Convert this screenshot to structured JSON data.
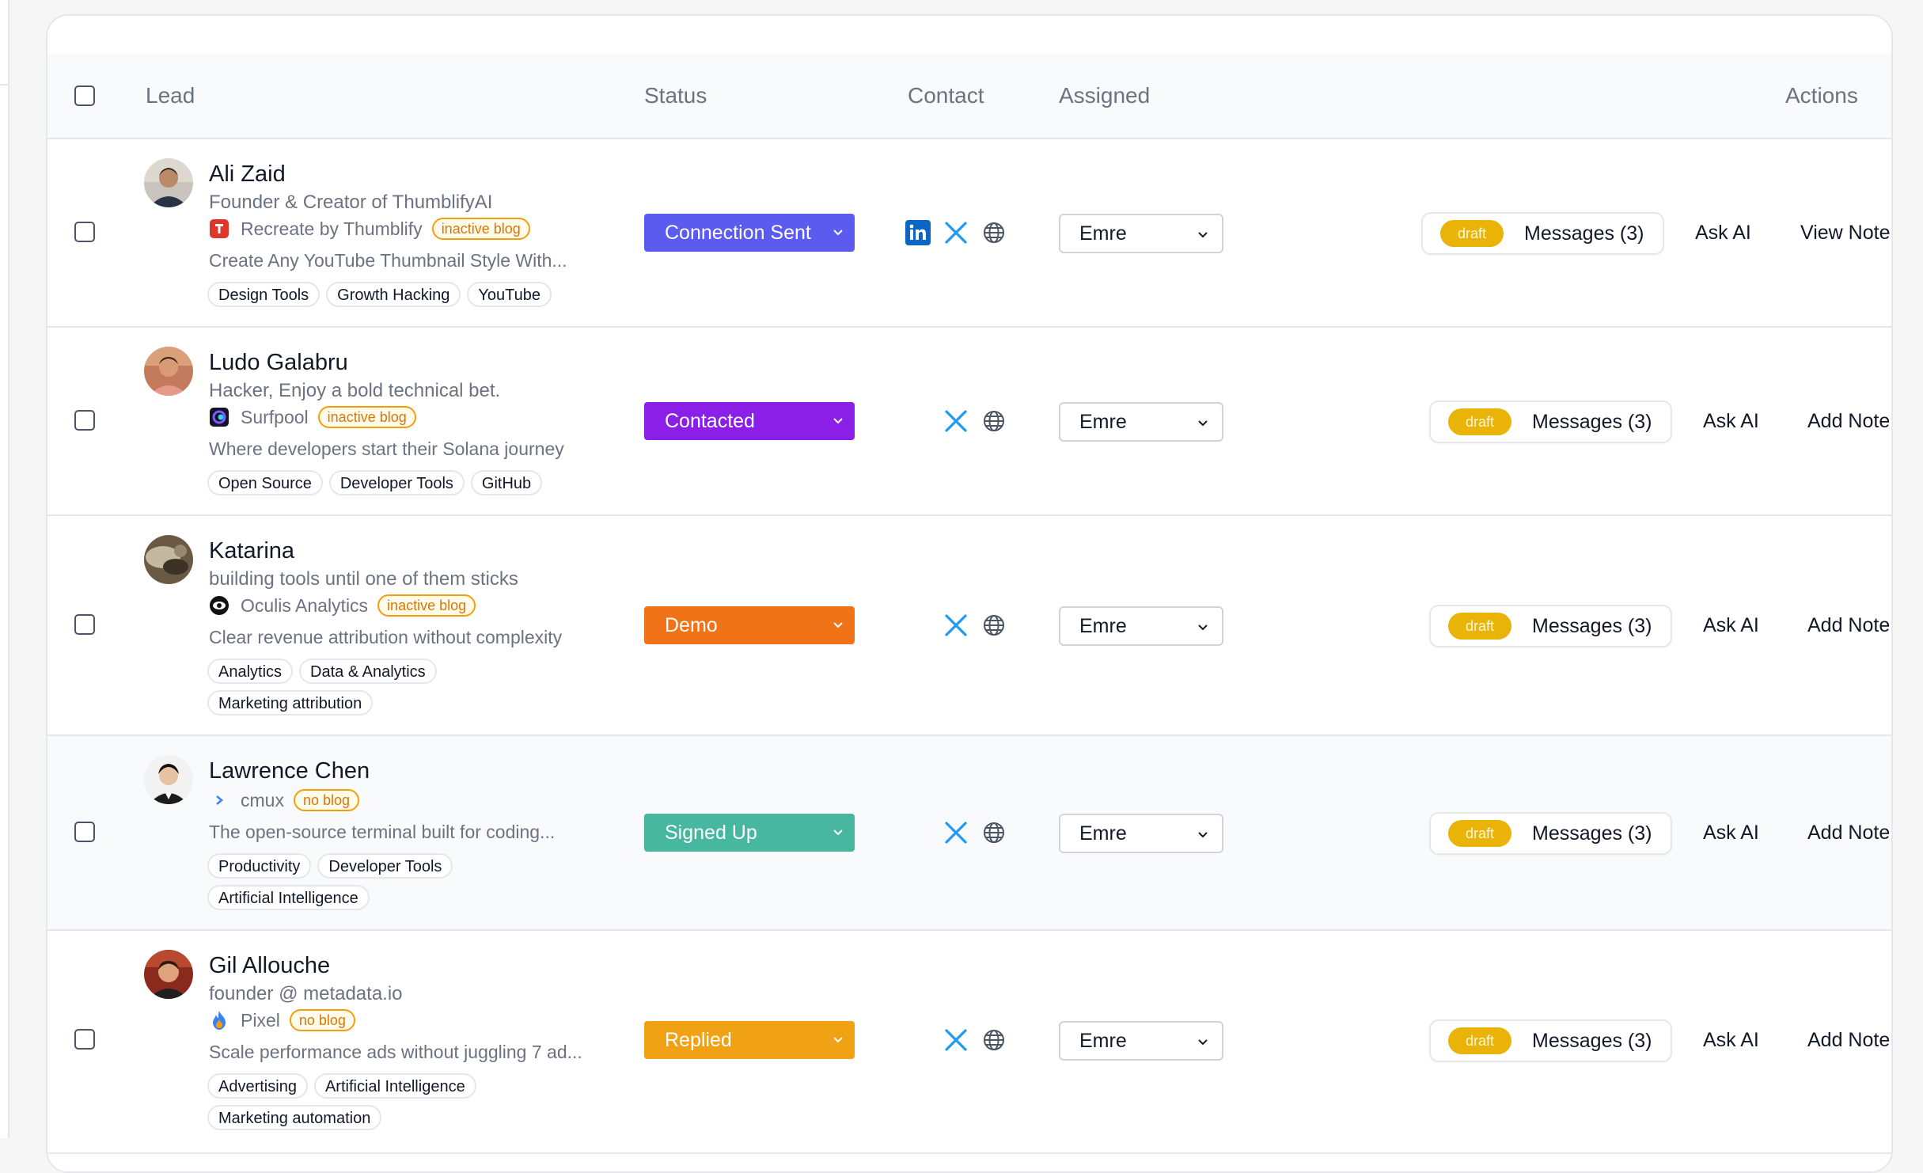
{
  "columns": {
    "lead": "Lead",
    "status": "Status",
    "contact": "Contact",
    "assigned": "Assigned",
    "actions": "Actions"
  },
  "colors": {
    "connection_sent": "#5b5bf0",
    "contacted": "#8b1fe8",
    "demo": "#f07317",
    "signed_up": "#47b7a0",
    "replied": "#f0a114",
    "draft": "#eab308",
    "badge_orange": "#d97706"
  },
  "leads": [
    {
      "name": "Ali Zaid",
      "subtitle": "Founder & Creator of ThumblifyAI",
      "company": "Recreate by Thumblify",
      "blog": "inactive blog",
      "description": "Create Any YouTube Thumbnail Style With...",
      "tags": [
        "Design Tools",
        "Growth Hacking",
        "YouTube"
      ],
      "status": "Connection Sent",
      "contact_icons": [
        "linkedin-icon",
        "x-icon",
        "globe-icon"
      ],
      "assigned": "Emre",
      "draft": "draft",
      "messages": "Messages (3)",
      "ask_ai": "Ask AI",
      "note": "View Note"
    },
    {
      "name": "Ludo Galabru",
      "subtitle": "Hacker, Enjoy a bold technical bet.",
      "company": "Surfpool",
      "blog": "inactive blog",
      "description": "Where developers start their Solana journey",
      "tags": [
        "Open Source",
        "Developer Tools",
        "GitHub"
      ],
      "status": "Contacted",
      "contact_icons": [
        "x-icon",
        "globe-icon"
      ],
      "assigned": "Emre",
      "draft": "draft",
      "messages": "Messages (3)",
      "ask_ai": "Ask AI",
      "note": "Add Note"
    },
    {
      "name": "Katarina",
      "subtitle": "building tools until one of them sticks",
      "company": "Oculis Analytics",
      "blog": "inactive blog",
      "description": "Clear revenue attribution without complexity",
      "tags": [
        "Analytics",
        "Data & Analytics",
        "Marketing attribution"
      ],
      "status": "Demo",
      "contact_icons": [
        "x-icon",
        "globe-icon"
      ],
      "assigned": "Emre",
      "draft": "draft",
      "messages": "Messages (3)",
      "ask_ai": "Ask AI",
      "note": "Add Note"
    },
    {
      "name": "Lawrence Chen",
      "subtitle": "",
      "company": "cmux",
      "blog": "no blog",
      "description": "The open-source terminal built for coding...",
      "tags": [
        "Productivity",
        "Developer Tools",
        "Artificial Intelligence"
      ],
      "status": "Signed Up",
      "contact_icons": [
        "x-icon",
        "globe-icon"
      ],
      "assigned": "Emre",
      "draft": "draft",
      "messages": "Messages (3)",
      "ask_ai": "Ask AI",
      "note": "Add Note"
    },
    {
      "name": "Gil Allouche",
      "subtitle": "founder @ metadata.io",
      "company": "Pixel",
      "blog": "no blog",
      "description": "Scale performance ads without juggling 7 ad...",
      "tags": [
        "Advertising",
        "Artificial Intelligence",
        "Marketing automation"
      ],
      "status": "Replied",
      "contact_icons": [
        "x-icon",
        "globe-icon"
      ],
      "assigned": "Emre",
      "draft": "draft",
      "messages": "Messages (3)",
      "ask_ai": "Ask AI",
      "note": "Add Note"
    }
  ]
}
